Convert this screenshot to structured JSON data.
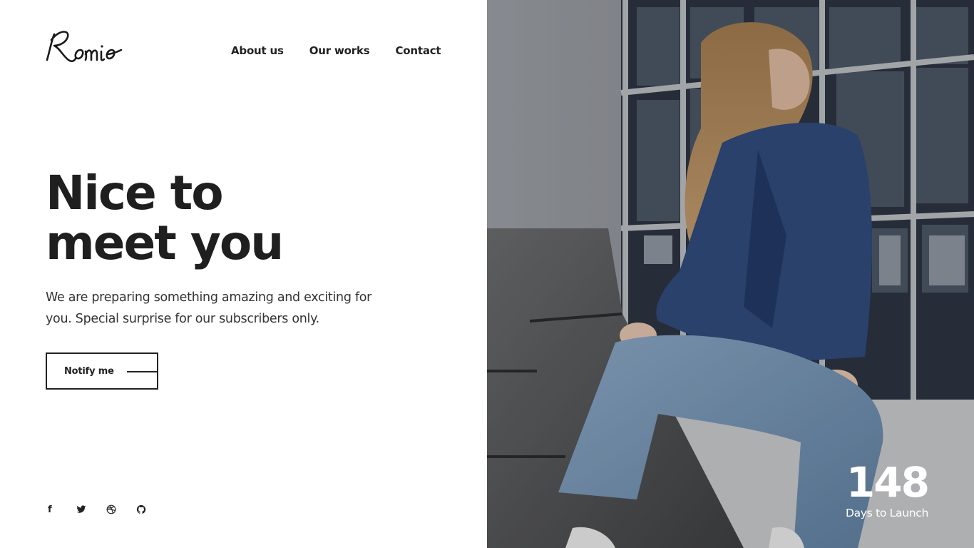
{
  "brand": {
    "logo_text": "Romio"
  },
  "nav": {
    "items": [
      {
        "label": "About us"
      },
      {
        "label": "Our works"
      },
      {
        "label": "Contact"
      }
    ]
  },
  "hero": {
    "title_line1": "Nice to",
    "title_line2": "meet you",
    "description": "We are preparing something amazing and exciting for you. Special surprise for our subscribers only.",
    "cta_label": "Notify me"
  },
  "social": {
    "icons": [
      "facebook-icon",
      "twitter-icon",
      "dribbble-icon",
      "github-icon"
    ],
    "facebook_glyph": "f"
  },
  "countdown": {
    "value": "148",
    "label": "Days to Launch"
  },
  "colors": {
    "text": "#222222",
    "background": "#ffffff",
    "overlay_text": "#ffffff"
  }
}
